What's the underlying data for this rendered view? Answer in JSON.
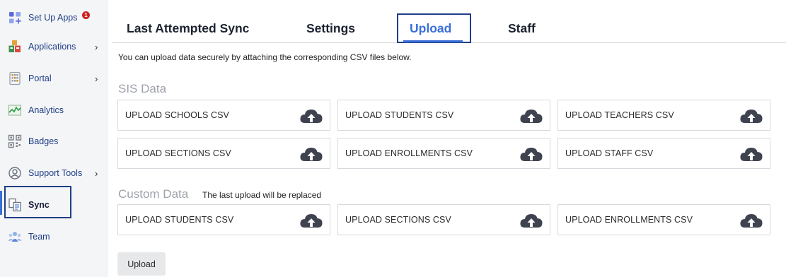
{
  "sidebar": {
    "items": [
      {
        "label": "Set Up Apps",
        "icon": "grid-plus-icon",
        "badge": "1"
      },
      {
        "label": "Applications",
        "icon": "app-blocks-icon",
        "chevron": "›"
      },
      {
        "label": "Portal",
        "icon": "portal-icon",
        "chevron": "›"
      },
      {
        "label": "Analytics",
        "icon": "analytics-icon"
      },
      {
        "label": "Badges",
        "icon": "qr-badge-icon"
      },
      {
        "label": "Support Tools",
        "icon": "support-person-icon",
        "chevron": "›"
      },
      {
        "label": "Sync",
        "icon": "sync-docs-icon",
        "active": true
      },
      {
        "label": "Team",
        "icon": "team-icon"
      }
    ]
  },
  "tabs": [
    {
      "label": "Last Attempted Sync"
    },
    {
      "label": "Settings"
    },
    {
      "label": "Upload",
      "active": true
    },
    {
      "label": "Staff"
    }
  ],
  "intro": "You can upload data securely by attaching the corresponding CSV files below.",
  "sis": {
    "title": "SIS Data",
    "cards": [
      "UPLOAD SCHOOLS CSV",
      "UPLOAD STUDENTS CSV",
      "UPLOAD TEACHERS CSV",
      "UPLOAD SECTIONS CSV",
      "UPLOAD ENROLLMENTS CSV",
      "UPLOAD STAFF CSV"
    ]
  },
  "custom": {
    "title": "Custom Data",
    "note": "The last upload will be replaced",
    "cards": [
      "UPLOAD STUDENTS CSV",
      "UPLOAD SECTIONS CSV",
      "UPLOAD ENROLLMENTS CSV"
    ]
  },
  "upload_button": "Upload",
  "colors": {
    "accent": "#3a6fd8",
    "frame": "#1f3e86",
    "nav_text": "#1f3e86",
    "badge": "#cc2222",
    "icon": "#3f4350"
  }
}
